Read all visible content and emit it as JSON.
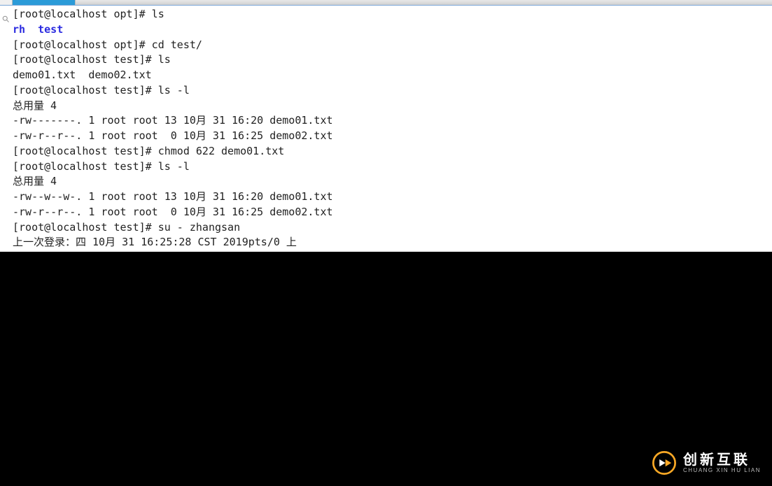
{
  "topbar": {
    "tabs": [
      {
        "name": "tab-search",
        "active": false
      },
      {
        "name": "tab-terminal",
        "active": true
      }
    ]
  },
  "terminal": {
    "lines": [
      {
        "seg": [
          {
            "t": "[root@localhost opt]# ls",
            "c": "plain"
          }
        ]
      },
      {
        "seg": [
          {
            "t": "rh",
            "c": "blue"
          },
          {
            "t": "  ",
            "c": "plain"
          },
          {
            "t": "test",
            "c": "blue"
          }
        ]
      },
      {
        "seg": [
          {
            "t": "[root@localhost opt]# cd test/",
            "c": "plain"
          }
        ]
      },
      {
        "seg": [
          {
            "t": "[root@localhost test]# ls",
            "c": "plain"
          }
        ]
      },
      {
        "seg": [
          {
            "t": "demo01.txt  demo02.txt",
            "c": "plain"
          }
        ]
      },
      {
        "seg": [
          {
            "t": "[root@localhost test]# ls -l",
            "c": "plain"
          }
        ]
      },
      {
        "seg": [
          {
            "t": "总用量 4",
            "c": "plain"
          }
        ]
      },
      {
        "seg": [
          {
            "t": "-rw-------. 1 root root 13 10月 31 16:20 demo01.txt",
            "c": "plain"
          }
        ]
      },
      {
        "seg": [
          {
            "t": "-rw-r--r--. 1 root root  0 10月 31 16:25 demo02.txt",
            "c": "plain"
          }
        ]
      },
      {
        "seg": [
          {
            "t": "[root@localhost test]# chmod 622 demo01.txt",
            "c": "plain"
          }
        ]
      },
      {
        "seg": [
          {
            "t": "[root@localhost test]# ls -l",
            "c": "plain"
          }
        ]
      },
      {
        "seg": [
          {
            "t": "总用量 4",
            "c": "plain"
          }
        ]
      },
      {
        "seg": [
          {
            "t": "-rw--w--w-. 1 root root 13 10月 31 16:20 demo01.txt",
            "c": "plain"
          }
        ]
      },
      {
        "seg": [
          {
            "t": "-rw-r--r--. 1 root root  0 10月 31 16:25 demo02.txt",
            "c": "plain"
          }
        ]
      },
      {
        "seg": [
          {
            "t": "[root@localhost test]# su - zhangsan",
            "c": "plain"
          }
        ]
      },
      {
        "seg": [
          {
            "t": "上一次登录：四 10月 31 16:25:28 CST 2019pts/0 上",
            "c": "plain"
          }
        ]
      }
    ]
  },
  "watermark": {
    "chinese": "创新互联",
    "pinyin": "CHUANG XIN HU LIAN"
  }
}
